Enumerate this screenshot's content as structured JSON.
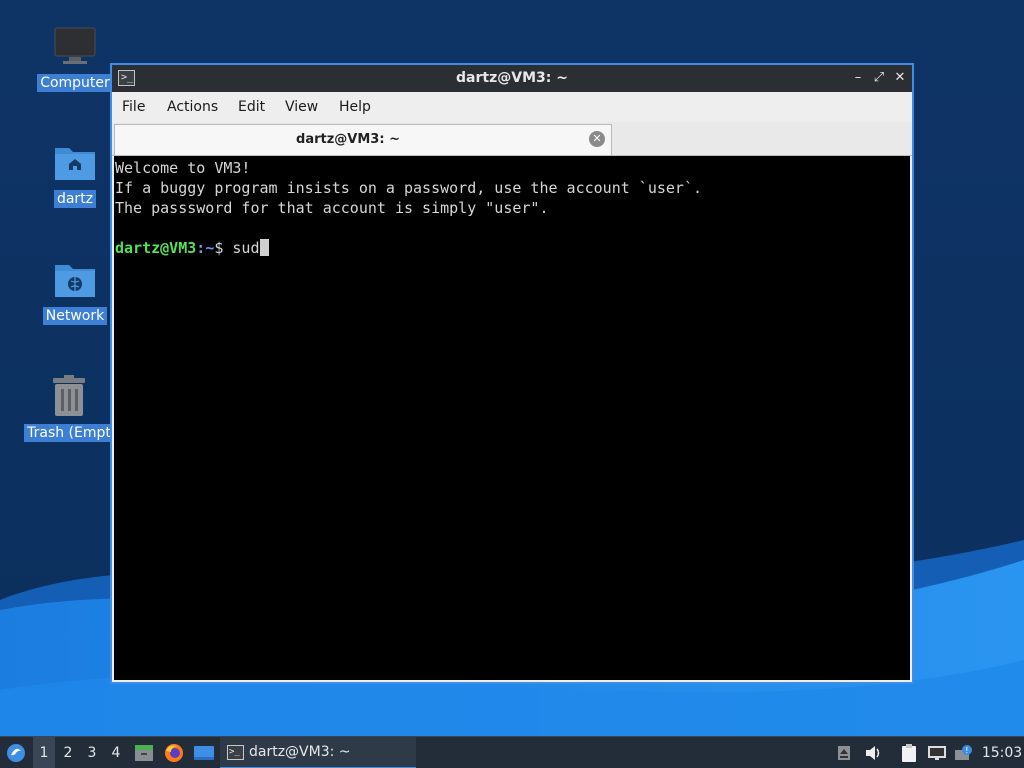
{
  "desktop": {
    "icons": [
      {
        "label": "Computer",
        "icon": "computer-icon"
      },
      {
        "label": "dartz",
        "icon": "home-folder-icon"
      },
      {
        "label": "Network",
        "icon": "network-folder-icon"
      },
      {
        "label": "Trash (Empt",
        "icon": "trash-icon"
      }
    ]
  },
  "window": {
    "title": "dartz@VM3: ~",
    "controls": {
      "minimize": "–",
      "maximize": "⤢",
      "close": "✕"
    },
    "menu": [
      "File",
      "Actions",
      "Edit",
      "View",
      "Help"
    ],
    "tab": {
      "label": "dartz@VM3: ~",
      "close": "✕"
    }
  },
  "terminal": {
    "lines": [
      "Welcome to VM3!",
      "If a buggy program insists on a password, use the account `user`.",
      "The passsword for that account is simply \"user\"."
    ],
    "prompt_user": "dartz@VM3",
    "prompt_sep": ":",
    "prompt_path": "~",
    "prompt_symbol": "$ ",
    "input": "sud"
  },
  "taskbar": {
    "start_icon": "start-menu-icon",
    "workspaces": [
      "1",
      "2",
      "3",
      "4"
    ],
    "active_workspace": "1",
    "launchers": [
      "file-manager-icon",
      "firefox-icon",
      "show-desktop-icon"
    ],
    "task_label": "dartz@VM3: ~",
    "tray": [
      "eject-icon",
      "volume-icon",
      "clipboard-icon",
      "network-icon",
      "updates-icon"
    ],
    "clock": "15:03"
  },
  "colors": {
    "accent": "#3f8ee5",
    "prompt_user": "#55e05a",
    "prompt_path": "#7b8cf5",
    "terminal_bg": "#000000",
    "titlebar": "#2b2f33"
  }
}
